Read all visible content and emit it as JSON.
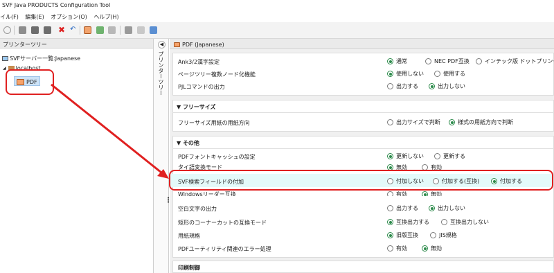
{
  "window": {
    "title": "SVF Java PRODUCTS Configuration Tool"
  },
  "menu": [
    "イル(F)",
    "編集(E)",
    "オプション(O)",
    "ヘルプ(H)"
  ],
  "left_panel": {
    "title": "プリンターツリー",
    "vertical_label": "プリンターツリー",
    "tree": {
      "root": "SVFサーバー一覧:Japanese",
      "host": "localhost",
      "leaf": "PDF"
    }
  },
  "right_panel": {
    "title": "PDF (Japanese)",
    "top_rows": [
      {
        "label": "Ank3/2漢字設定",
        "options": [
          "通常",
          "NEC PDF互換",
          "インテック版 ドットプリンター互換"
        ],
        "selected": 0
      },
      {
        "label": "ページツリー複数ノード化機能",
        "options": [
          "使用しない",
          "使用する"
        ],
        "selected": 0
      },
      {
        "label": "PJLコマンドの出力",
        "options": [
          "出力する",
          "出力しない"
        ],
        "selected": 1
      }
    ],
    "free_size": {
      "title": "フリーサイズ",
      "rows": [
        {
          "label": "フリーサイズ用紙の用紙方向",
          "options": [
            "出力サイズで判断",
            "様式の用紙方向で判断"
          ],
          "selected": 1
        }
      ]
    },
    "other": {
      "title": "その他",
      "rows": [
        {
          "label": "PDFフォントキャッシュの設定",
          "options": [
            "更新しない",
            "更新する"
          ],
          "selected": 0
        },
        {
          "label": "タイ語変換モード",
          "options": [
            "無効",
            "有効"
          ],
          "selected": 0
        },
        {
          "label": "SVF検索フィールドの付加",
          "options": [
            "付加しない",
            "付加する(互換)",
            "付加する"
          ],
          "selected": 2
        },
        {
          "label": "Windowsリーダー互換",
          "options": [
            "有効",
            "無効"
          ],
          "selected": 1
        },
        {
          "label": "空白文字の出力",
          "options": [
            "出力する",
            "出力しない"
          ],
          "selected": 1
        },
        {
          "label": "矩形のコーナーカットの互換モード",
          "options": [
            "互換出力する",
            "互換出力しない"
          ],
          "selected": 0
        },
        {
          "label": "用紙規格",
          "options": [
            "旧版互換",
            "JIS規格"
          ],
          "selected": 0
        },
        {
          "label": "PDFユーティリティ関連のエラー処理",
          "options": [
            "有効",
            "無効"
          ],
          "selected": 1
        }
      ]
    },
    "print_control": {
      "title": "印刷制御"
    }
  },
  "colors": {
    "highlight": "#e02020",
    "radio_selected": "#2b8a4a",
    "highlight_row": "#e4fafa"
  }
}
